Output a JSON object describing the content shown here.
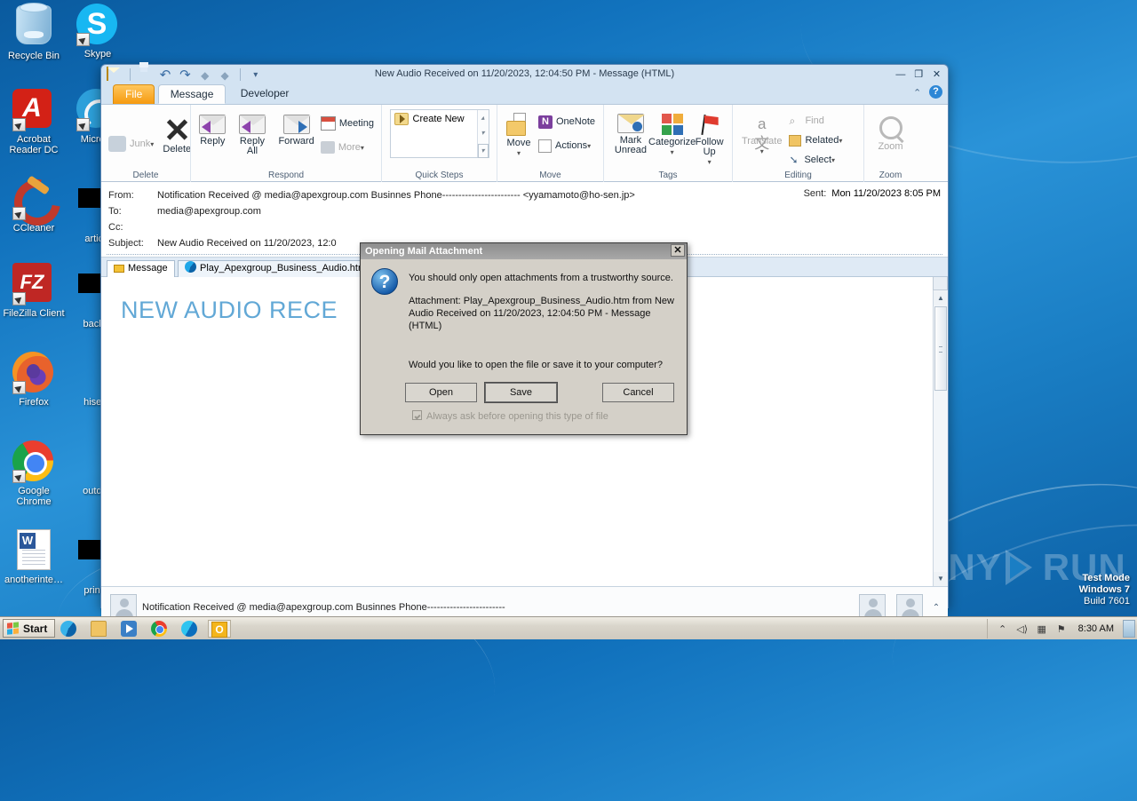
{
  "desktop": {
    "icons_col1": [
      {
        "label": "Recycle Bin",
        "icon": "recycle-bin-icon",
        "art": "art-recycle",
        "shortcut": false
      },
      {
        "label": "Acrobat Reader DC",
        "icon": "acrobat-reader-icon",
        "art": "art-acrobat",
        "shortcut": true
      },
      {
        "label": "CCleaner",
        "icon": "ccleaner-icon",
        "art": "art-ccleaner",
        "shortcut": true
      },
      {
        "label": "FileZilla Client",
        "icon": "filezilla-icon",
        "art": "art-filezilla",
        "shortcut": true
      },
      {
        "label": "Firefox",
        "icon": "firefox-icon",
        "art": "art-firefox",
        "shortcut": true
      },
      {
        "label": "Google Chrome",
        "icon": "google-chrome-icon",
        "art": "art-chrome",
        "shortcut": true
      },
      {
        "label": "anotherinte…",
        "icon": "word-document-icon",
        "art": "art-word",
        "shortcut": false
      }
    ],
    "icons_col2": [
      {
        "label": "Skype",
        "icon": "skype-icon",
        "art": "art-skype",
        "shortcut": true
      },
      {
        "label": "Microsо",
        "icon": "microsoft-teams-icon",
        "art": "art-msteams",
        "shortcut": true
      },
      {
        "label": "article",
        "icon": "file-icon",
        "art": "art-black",
        "shortcut": false
      },
      {
        "label": "backgr",
        "icon": "file-icon",
        "art": "art-black",
        "shortcut": false
      },
      {
        "label": "hisedit",
        "icon": "file-icon",
        "art": "art-blank",
        "shortcut": false
      },
      {
        "label": "outdoo",
        "icon": "file-icon",
        "art": "art-blank",
        "shortcut": false
      },
      {
        "label": "printer",
        "icon": "file-icon",
        "art": "art-black",
        "shortcut": false
      }
    ],
    "watermark": "ANY RUN",
    "watermark_left": "A",
    "watermark_mid": "NY",
    "watermark_right": "RUN",
    "test_mode_line1": "Test Mode",
    "test_mode_line2": "Windows 7",
    "test_mode_line3": "Build 7601"
  },
  "window": {
    "title": "New Audio Received on 11/20/2023, 12:04:50 PM  -  Message (HTML)",
    "minimize": "—",
    "maximize": "❐",
    "close": "✕",
    "qat": {
      "envelope": "envelope-icon",
      "save": "save-icon",
      "undo": "↶",
      "redo": "↷",
      "prev": "◆",
      "next": "◆",
      "dropdown": "▾"
    },
    "ribbon_collapse": "⌃",
    "help": "?"
  },
  "tabs": [
    {
      "label": "File",
      "state": "file"
    },
    {
      "label": "Message",
      "state": "active"
    },
    {
      "label": "Developer",
      "state": "normal"
    }
  ],
  "ribbon": {
    "groups": [
      {
        "name": "Delete",
        "label": "Delete",
        "buttons": [
          {
            "label": "Junk",
            "icon": "junk-icon",
            "dim": true,
            "caret": "▾"
          },
          {
            "label": "Delete",
            "icon": "delete-x-icon",
            "dim": false,
            "caret": ""
          }
        ]
      },
      {
        "name": "Respond",
        "label": "Respond",
        "buttons": [
          {
            "label": "Reply",
            "icon": "reply-icon",
            "dim": false
          },
          {
            "label": "Reply All",
            "icon": "reply-all-icon",
            "dim": false
          },
          {
            "label": "Forward",
            "icon": "forward-icon",
            "dim": false
          },
          {
            "label": "Meeting",
            "icon": "meeting-icon",
            "dim": false
          },
          {
            "label": "More",
            "icon": "more-icon",
            "dim": true,
            "caret": "▾"
          }
        ]
      },
      {
        "name": "Quick Steps",
        "label": "Quick Steps",
        "item": "Create New",
        "item_icon": "quick-step-icon"
      },
      {
        "name": "Move",
        "label": "Move",
        "buttons": [
          {
            "label": "Move",
            "icon": "move-folder-icon",
            "caret": "▾"
          },
          {
            "label": "OneNote",
            "icon": "onenote-icon"
          },
          {
            "label": "Actions",
            "icon": "actions-icon",
            "caret": "▾"
          }
        ]
      },
      {
        "name": "Tags",
        "label": "Tags",
        "buttons": [
          {
            "label": "Mark Unread",
            "icon": "mark-unread-icon"
          },
          {
            "label": "Categorize",
            "icon": "categorize-icon",
            "caret": "▾"
          },
          {
            "label": "Follow Up",
            "icon": "follow-up-flag-icon",
            "caret": "▾"
          }
        ]
      },
      {
        "name": "Editing",
        "label": "Editing",
        "buttons": [
          {
            "label": "Translate",
            "icon": "translate-icon",
            "dim": true,
            "caret": "▾"
          },
          {
            "label": "Find",
            "icon": "find-icon",
            "dim": true
          },
          {
            "label": "Related",
            "icon": "related-icon",
            "dim": false,
            "caret": "▾"
          },
          {
            "label": "Select",
            "icon": "select-icon",
            "dim": false,
            "caret": "▾"
          }
        ]
      },
      {
        "name": "Zoom",
        "label": "Zoom",
        "buttons": [
          {
            "label": "Zoom",
            "icon": "zoom-magnifier-icon",
            "dim": true
          }
        ]
      }
    ]
  },
  "header": {
    "from_label": "From:",
    "from_value": "Notification Received @ media@apexgroup.com Businnes Phone------------------------  <yyamamoto@ho-sen.jp>",
    "to_label": "To:",
    "to_value": "media@apexgroup.com",
    "cc_label": "Cc:",
    "cc_value": "",
    "subject_label": "Subject:",
    "subject_value": "New Audio Received on 11/20/2023, 12:0",
    "sent_label": "Sent:",
    "sent_value": "Mon 11/20/2023 8:05 PM"
  },
  "message_tabs": [
    {
      "label": "Message",
      "icon": "envelope-icon",
      "active": true
    },
    {
      "label": "Play_Apexgroup_Business_Audio.htm",
      "icon": "internet-explorer-icon",
      "active": false
    }
  ],
  "body": {
    "text": "NEW AUDIO RECE"
  },
  "people_pane": {
    "text": "Notification Received @ media@apexgroup.com Businnes Phone------------------------",
    "chevron": "⌃"
  },
  "dialog": {
    "title": "Opening Mail Attachment",
    "close": "✕",
    "icon": "question-mark-icon",
    "line1": "You should only open attachments from a trustworthy source.",
    "line2": "Attachment: Play_Apexgroup_Business_Audio.htm from New Audio Received on 11/20/2023, 12:04:50 PM - Message (HTML)",
    "line3": "Would you like to open the file or save it to your computer?",
    "buttons": [
      {
        "label": "Open",
        "name": "open-button",
        "class": "b-open"
      },
      {
        "label": "Save",
        "name": "save-button",
        "class": "b-save"
      },
      {
        "label": "Cancel",
        "name": "cancel-button",
        "class": "b-cancel"
      }
    ],
    "checkbox_label": "Always ask before opening this type of file",
    "checkbox_checked": true
  },
  "taskbar": {
    "start_label": "Start",
    "items": [
      {
        "name": "taskbar-internet-explorer",
        "icon": "internet-explorer-icon",
        "cls": "tbg-ie",
        "active": false
      },
      {
        "name": "taskbar-windows-explorer",
        "icon": "folder-icon",
        "cls": "tbg-exp",
        "active": false
      },
      {
        "name": "taskbar-media-player",
        "icon": "media-player-icon",
        "cls": "tbg-wmp",
        "active": false
      },
      {
        "name": "taskbar-chrome",
        "icon": "google-chrome-icon",
        "cls": "tbg-chrome",
        "active": false
      },
      {
        "name": "taskbar-edge",
        "icon": "edge-icon",
        "cls": "tbg-edge",
        "active": false
      },
      {
        "name": "taskbar-outlook",
        "icon": "outlook-icon",
        "cls": "tbg-out",
        "active": true
      }
    ],
    "tray": [
      {
        "name": "tray-show-hidden-icons",
        "glyph": "⌃"
      },
      {
        "name": "tray-volume-icon",
        "glyph": "🔊"
      },
      {
        "name": "tray-network-icon",
        "glyph": "▦"
      },
      {
        "name": "tray-action-center-icon",
        "glyph": "⚑"
      }
    ],
    "clock": "8:30 AM"
  },
  "colors": {
    "file_tab": "#f59a10",
    "body_text": "#62a8d6",
    "desktop_blue": "#1a7ec4",
    "dialog_face": "#d4d0c8"
  }
}
